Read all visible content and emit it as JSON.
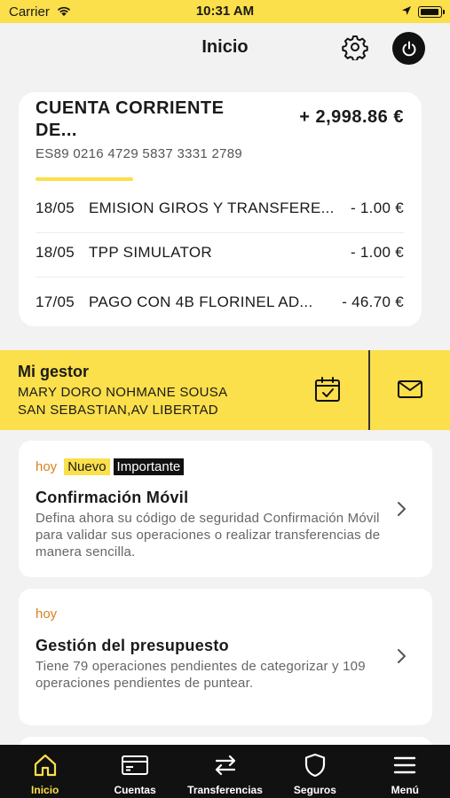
{
  "status_bar": {
    "carrier": "Carrier",
    "time": "10:31 AM"
  },
  "header": {
    "title": "Inicio"
  },
  "account": {
    "name": "CUENTA CORRIENTE DE...",
    "balance": "+ 2,998.86 €",
    "iban": "ES89 0216 4729 5837 3331 2789",
    "transactions": [
      {
        "date": "18/05",
        "concept": "EMISION GIROS Y TRANSFERE...",
        "amount": "- 1.00 €"
      },
      {
        "date": "18/05",
        "concept": "TPP SIMULATOR",
        "amount": "- 1.00 €"
      },
      {
        "date": "17/05",
        "concept": "PAGO CON 4B FLORINEL AD...",
        "amount": "- 46.70 €"
      }
    ]
  },
  "gestor": {
    "label": "Mi gestor",
    "name": "MARY DORO NOHMANE SOUSA",
    "office": "SAN SEBASTIAN,AV LIBERTAD"
  },
  "notifications": [
    {
      "date": "hoy",
      "badges": [
        "Nuevo",
        "Importante"
      ],
      "title": "Confirmación Móvil",
      "body": "Defina ahora su código de seguridad Confirmación Móvil para validar sus operaciones o realizar transferencias de manera sencilla."
    },
    {
      "date": "hoy",
      "title": "Gestión del presupuesto",
      "body": "Tiene 79 operaciones pendientes de categorizar y 109 operaciones pendientes de puntear."
    }
  ],
  "tabbar": {
    "items": [
      {
        "label": "Inicio",
        "icon": "home-icon",
        "active": true
      },
      {
        "label": "Cuentas",
        "icon": "card-icon"
      },
      {
        "label": "Transferencias",
        "icon": "transfer-icon"
      },
      {
        "label": "Seguros",
        "icon": "shield-icon"
      },
      {
        "label": "Menú",
        "icon": "menu-icon"
      }
    ]
  },
  "colors": {
    "accent": "#fbdf4b",
    "tabbar": "#111111",
    "date_orange": "#d9821a"
  }
}
